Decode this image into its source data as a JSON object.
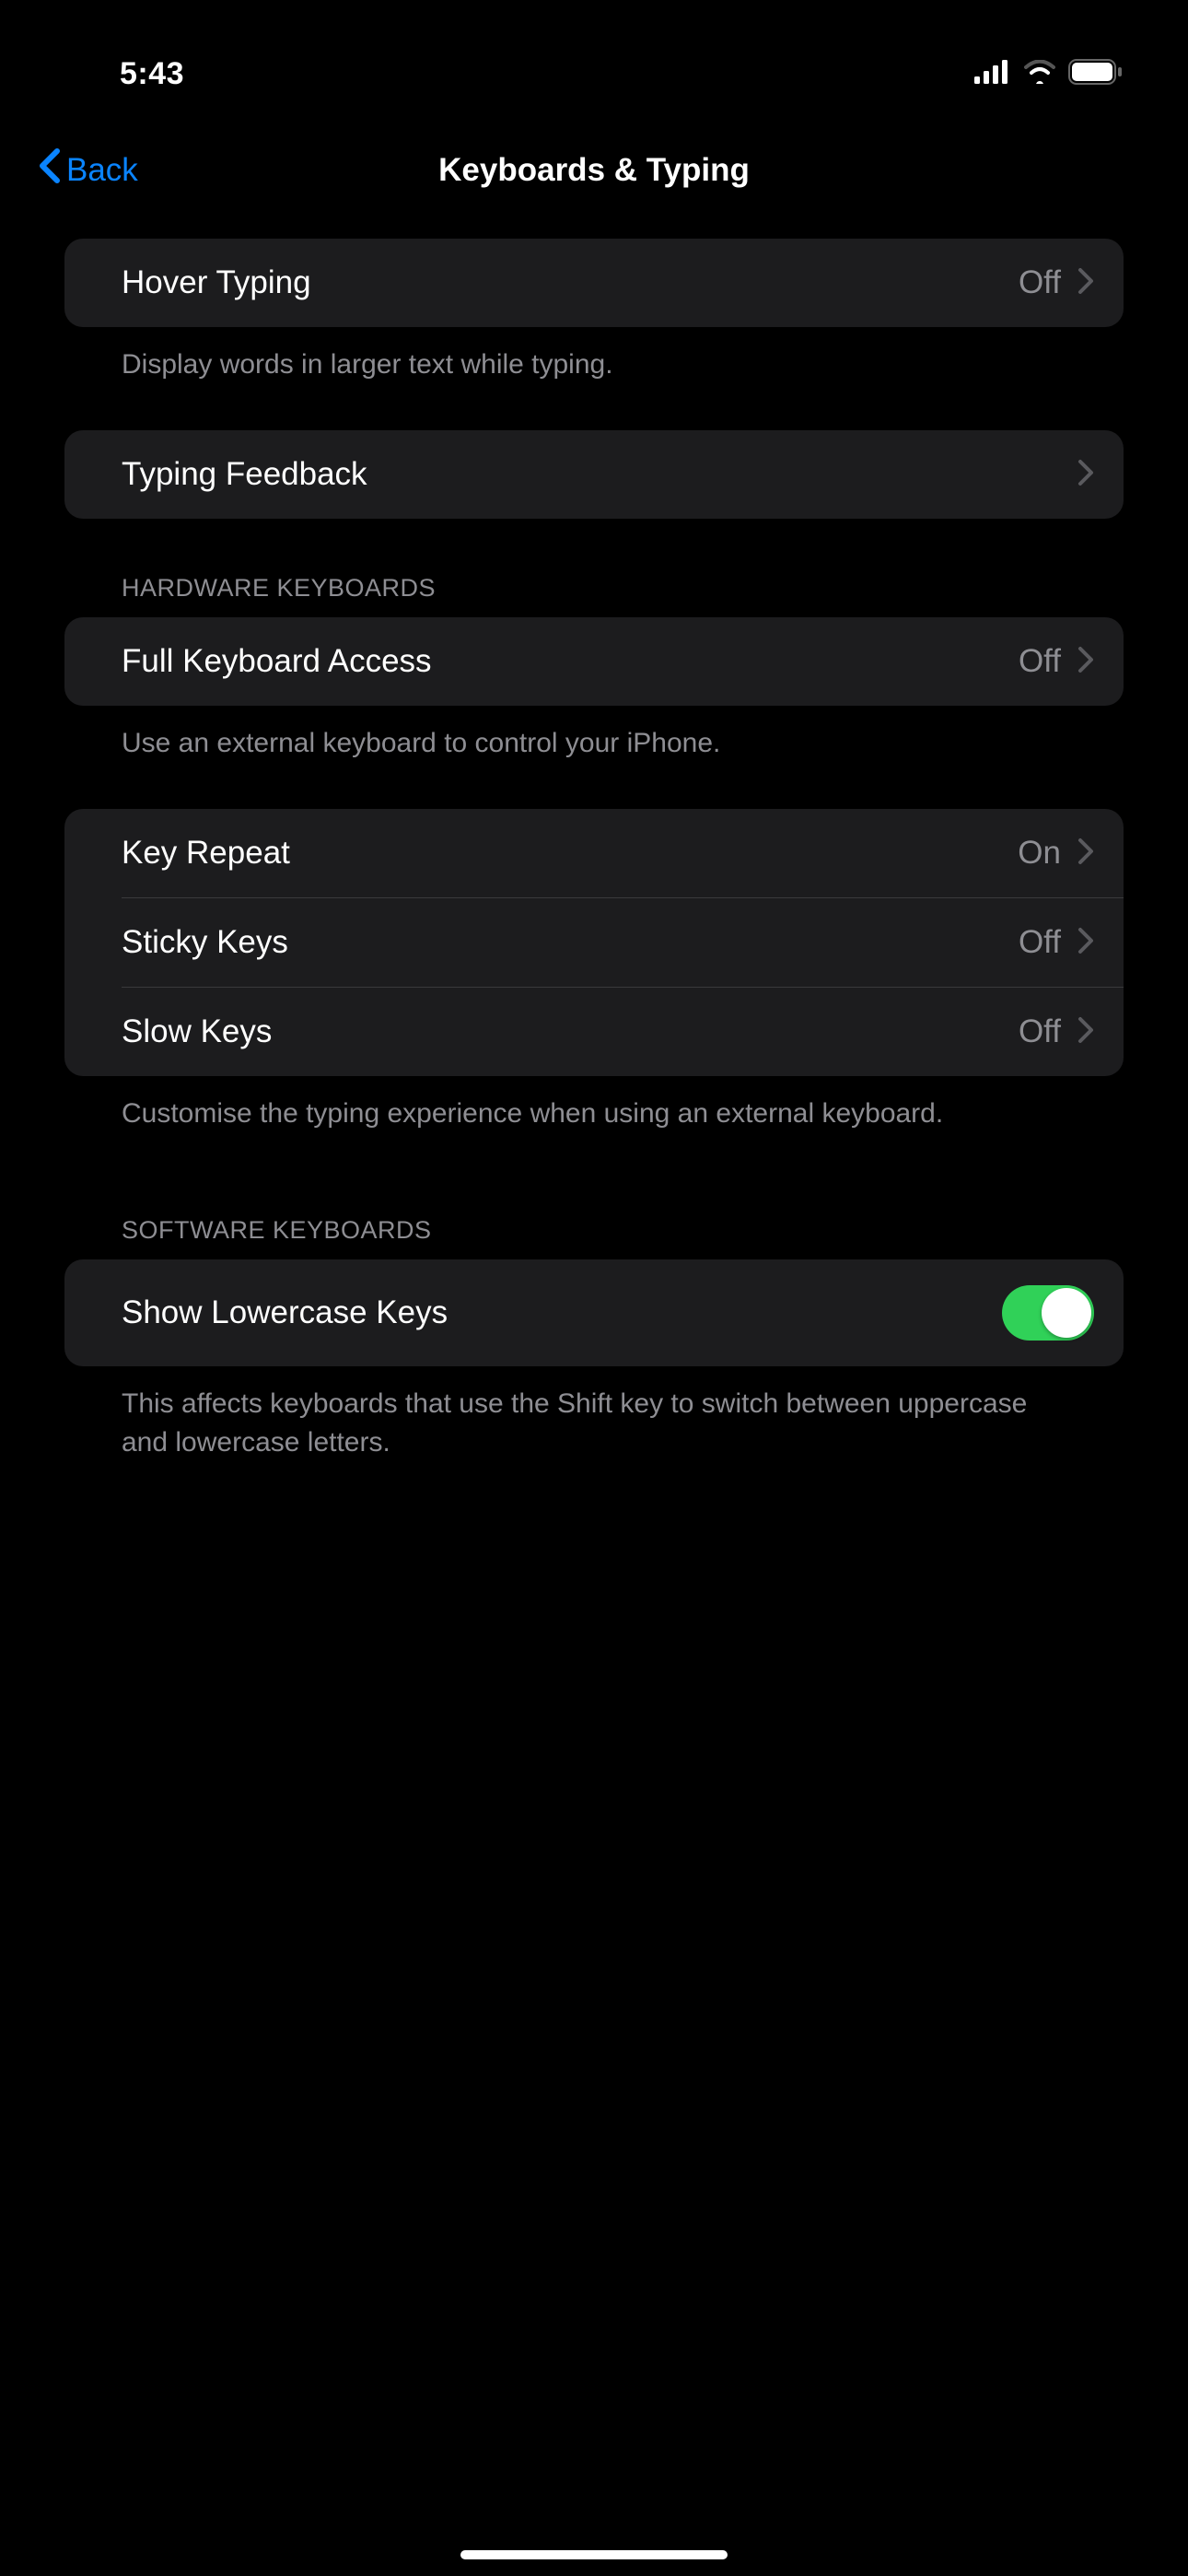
{
  "status": {
    "time": "5:43"
  },
  "nav": {
    "back_label": "Back",
    "title": "Keyboards & Typing"
  },
  "sections": {
    "hover_typing": {
      "label": "Hover Typing",
      "value": "Off",
      "footer": "Display words in larger text while typing."
    },
    "typing_feedback": {
      "label": "Typing Feedback"
    },
    "hardware_header": "HARDWARE KEYBOARDS",
    "full_keyboard_access": {
      "label": "Full Keyboard Access",
      "value": "Off",
      "footer": "Use an external keyboard to control your iPhone."
    },
    "key_repeat": {
      "label": "Key Repeat",
      "value": "On"
    },
    "sticky_keys": {
      "label": "Sticky Keys",
      "value": "Off"
    },
    "slow_keys": {
      "label": "Slow Keys",
      "value": "Off"
    },
    "hardware_footer": "Customise the typing experience when using an external keyboard.",
    "software_header": "SOFTWARE KEYBOARDS",
    "show_lowercase_keys": {
      "label": "Show Lowercase Keys",
      "footer": "This affects keyboards that use the Shift key to switch between uppercase and lowercase letters."
    }
  }
}
